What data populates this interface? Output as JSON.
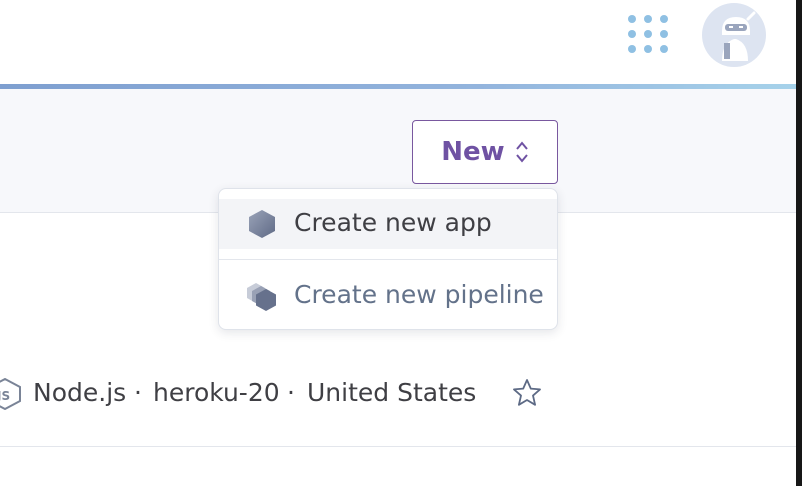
{
  "header": {
    "apps_menu_icon": "apps-grid-icon",
    "avatar_icon": "ninja-avatar-icon"
  },
  "toolbar": {
    "new_label": "New",
    "new_icon": "chevron-up-down-icon"
  },
  "dropdown": {
    "items": [
      {
        "label": "Create new app",
        "icon": "hexagon-icon"
      },
      {
        "label": "Create new pipeline",
        "icon": "pipeline-hexagons-icon"
      }
    ]
  },
  "app_row": {
    "language": "Node.js",
    "stack": "heroku-20",
    "region": "United States",
    "separator": "·",
    "language_icon": "nodejs-icon",
    "favorite_icon": "star-icon"
  },
  "colors": {
    "accent": "#79589f",
    "subheader_bg": "#f7f8fb",
    "apps_grid": "#8fc0e3",
    "text": "#3f3f44",
    "muted_text": "#63728a"
  }
}
